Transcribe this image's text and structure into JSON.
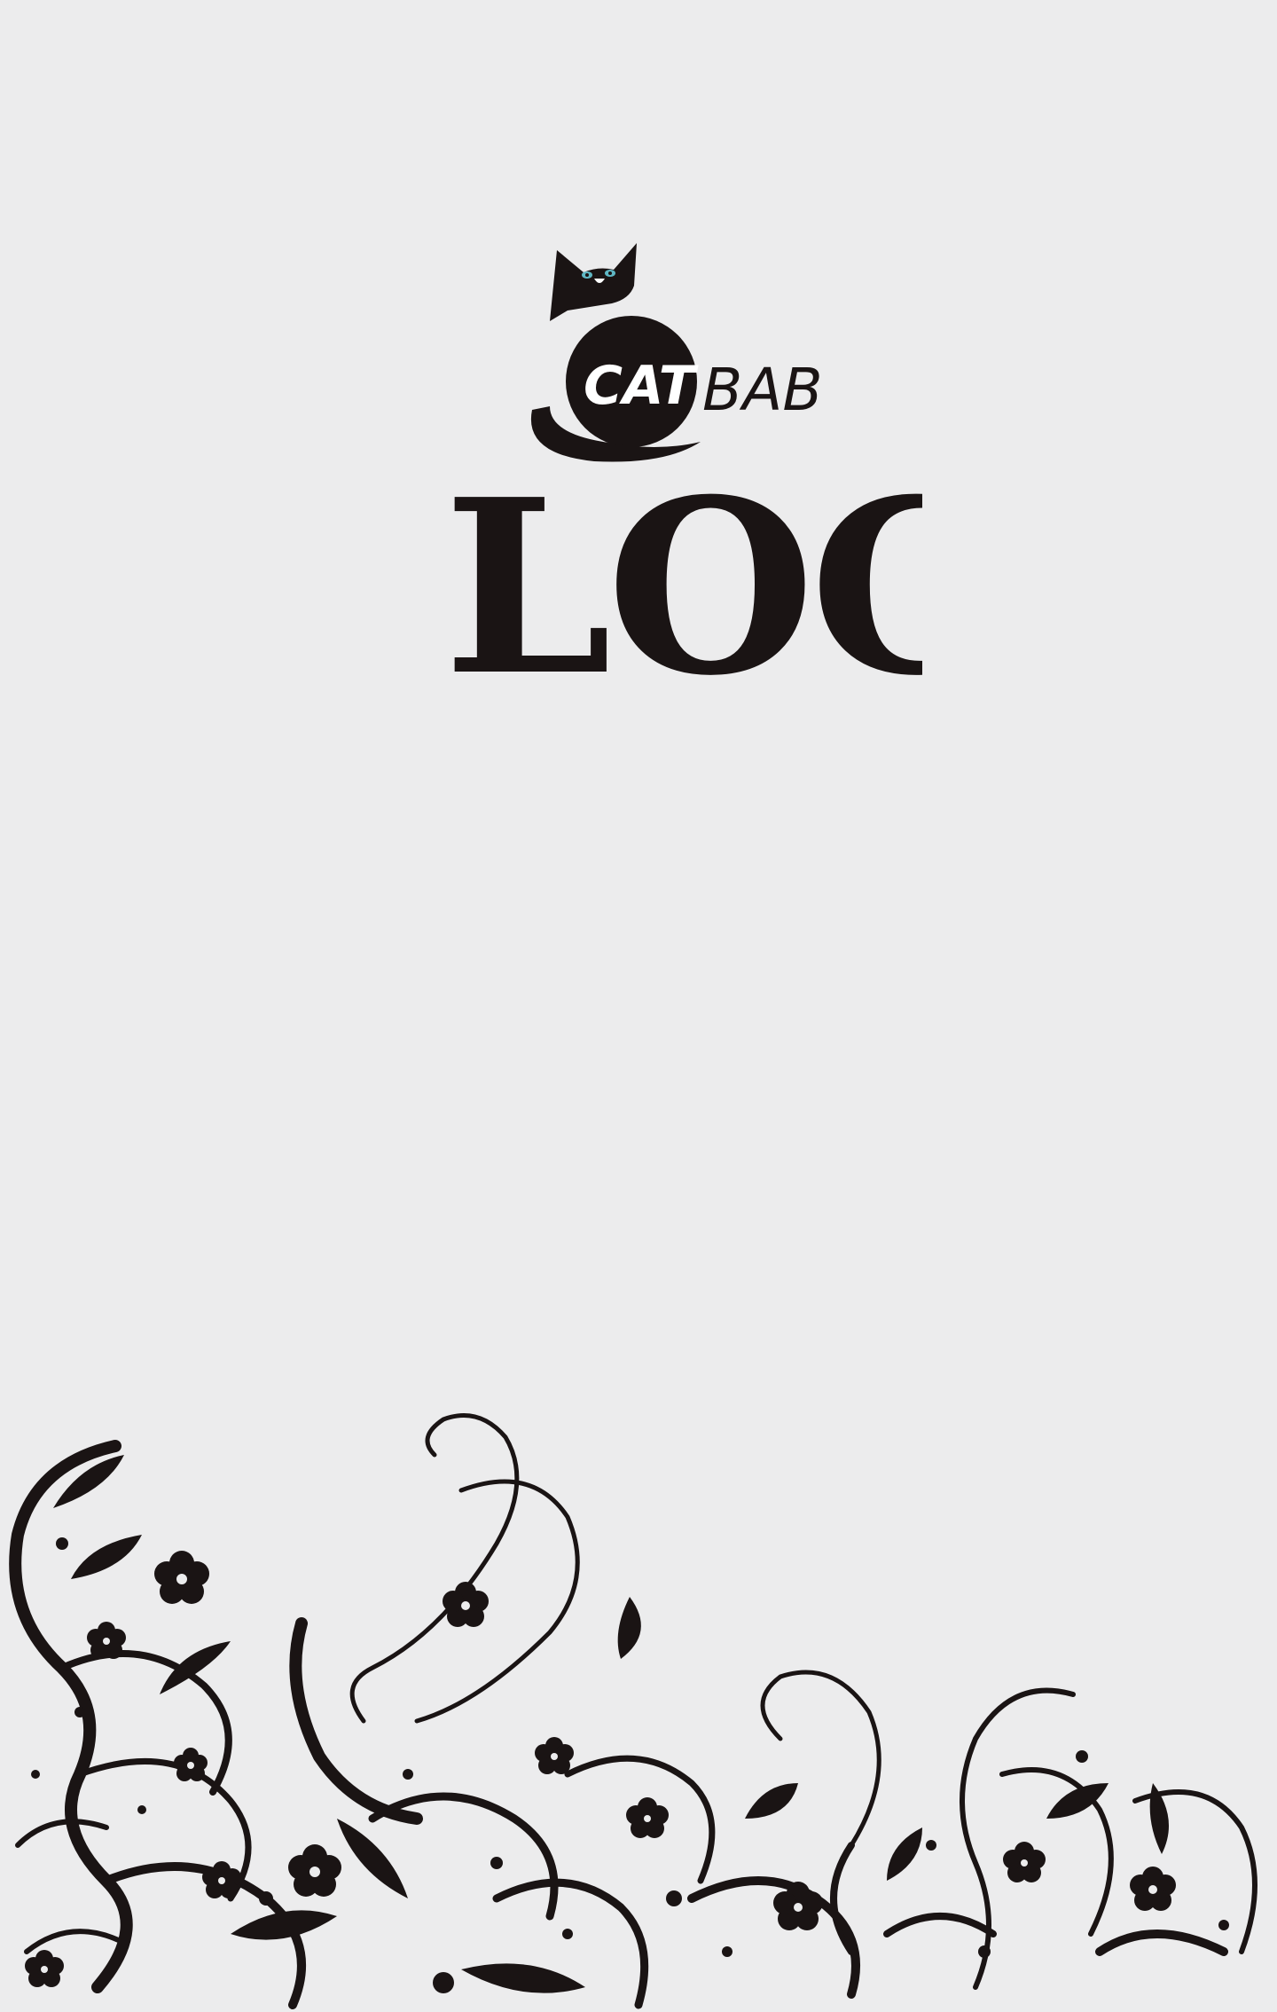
{
  "brand": {
    "logo_text_cat": "CAT",
    "logo_text_bab": "BAB",
    "icon": "cat-icon"
  },
  "page": {
    "title": "LOGIN"
  },
  "colors": {
    "background": "#ececed",
    "ink": "#1a1414",
    "cat_eye": "#5fb7c4"
  },
  "decoration": {
    "icon": "floral-ornament"
  }
}
